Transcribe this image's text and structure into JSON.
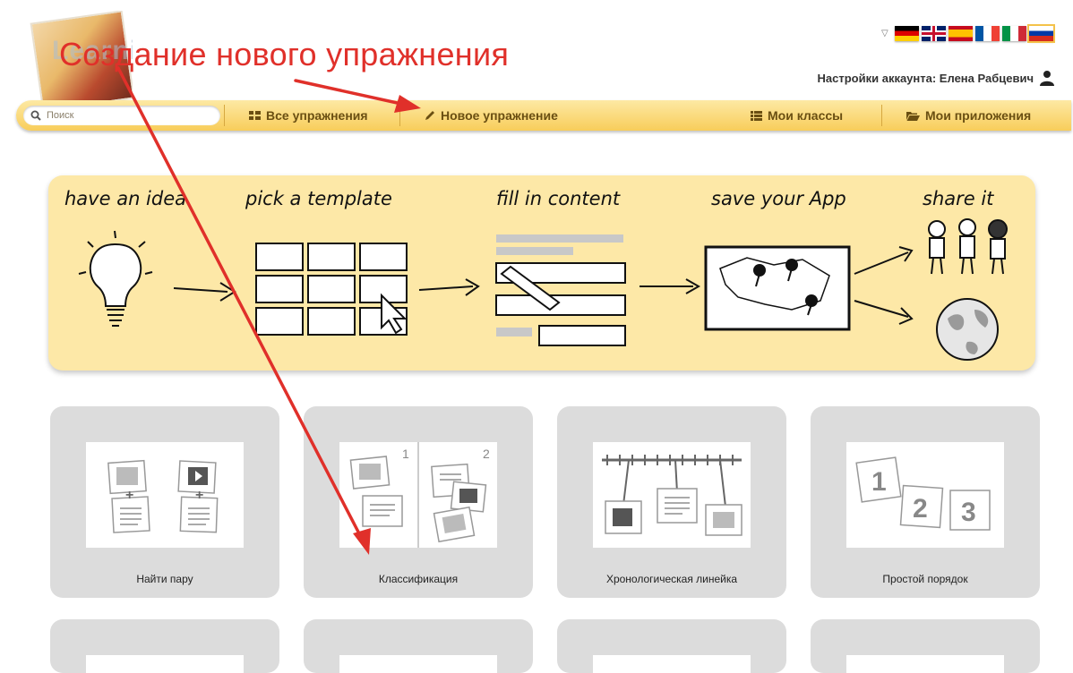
{
  "annotation": {
    "title": "Создание нового упражнения",
    "arrow_color": "#e0302a"
  },
  "logo": {
    "text": "LearningApps.org"
  },
  "languages": [
    {
      "code": "de",
      "icon": "flag-germany-icon"
    },
    {
      "code": "en",
      "icon": "flag-uk-icon"
    },
    {
      "code": "es",
      "icon": "flag-spain-icon"
    },
    {
      "code": "fr",
      "icon": "flag-france-icon"
    },
    {
      "code": "it",
      "icon": "flag-italy-icon"
    },
    {
      "code": "ru",
      "icon": "flag-russia-icon",
      "selected": true
    }
  ],
  "account": {
    "label": "Настройки аккаунта: Елена Рабцевич",
    "icon": "user-icon"
  },
  "navbar": {
    "search_placeholder": "Поиск",
    "all_exercises": "Все упражнения",
    "new_exercise": "Новое упражнение",
    "my_classes": "Мои классы",
    "my_apps": "Мои приложения",
    "background": "#f8cd5a"
  },
  "banner": {
    "steps": [
      "have an idea",
      "pick a template",
      "fill in content",
      "save your App",
      "share it"
    ],
    "background": "#fde8a7"
  },
  "templates": [
    {
      "label": "Найти пару",
      "icon": "pair-matching-icon"
    },
    {
      "label": "Классификация",
      "icon": "classification-icon"
    },
    {
      "label": "Хронологическая линейка",
      "icon": "timeline-icon"
    },
    {
      "label": "Простой порядок",
      "icon": "simple-order-icon"
    }
  ]
}
